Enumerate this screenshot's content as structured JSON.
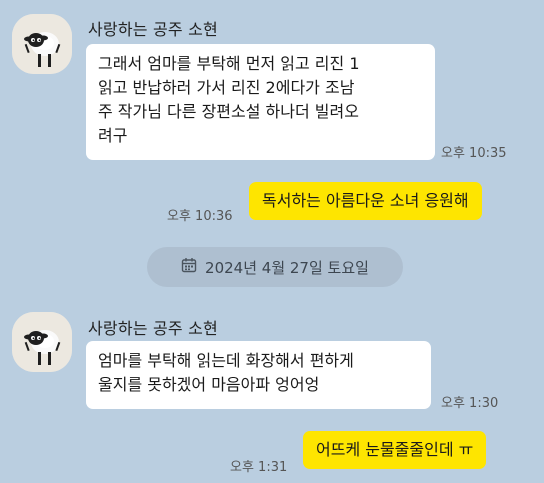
{
  "messages": [
    {
      "sender": "사랑하는 공주 소현",
      "text": "그래서 엄마를 부탁해 먼저 읽고 리진 1 읽고 반납하러 가서 리진 2에다가 조남주 작가님 다른 장편소설 하나더 빌려오려구",
      "lines": [
        "그래서 엄마를 부탁해 먼저 읽고 리진 1",
        "읽고 반납하러 가서 리진 2에다가 조남",
        "주 작가님 다른 장편소설 하나더 빌려오",
        "려구"
      ],
      "time": "오후 10:35"
    },
    {
      "text": "독서하는 아름다운 소녀 응원해",
      "time": "오후 10:36"
    },
    {
      "date": "2024년 4월 27일 토요일"
    },
    {
      "sender": "사랑하는 공주 소현",
      "text": "엄마를 부탁해 읽는데 화장해서 편하게 울지를 못하겠어 마음아파 엉어엉",
      "lines": [
        "엄마를 부탁해 읽는데 화장해서 편하게",
        "울지를 못하겠어 마음아파 엉어엉"
      ],
      "time": "오후 1:30"
    },
    {
      "text": "어뜨케 눈물줄줄인데 ㅠ",
      "time": "오후 1:31"
    }
  ],
  "icons": {
    "avatar": "sheep-avatar-icon",
    "date": "calendar-icon"
  },
  "colors": {
    "background": "#bacee0",
    "incoming_bubble": "#ffffff",
    "outgoing_bubble": "#fee500",
    "date_pill": "#aebfd0"
  }
}
